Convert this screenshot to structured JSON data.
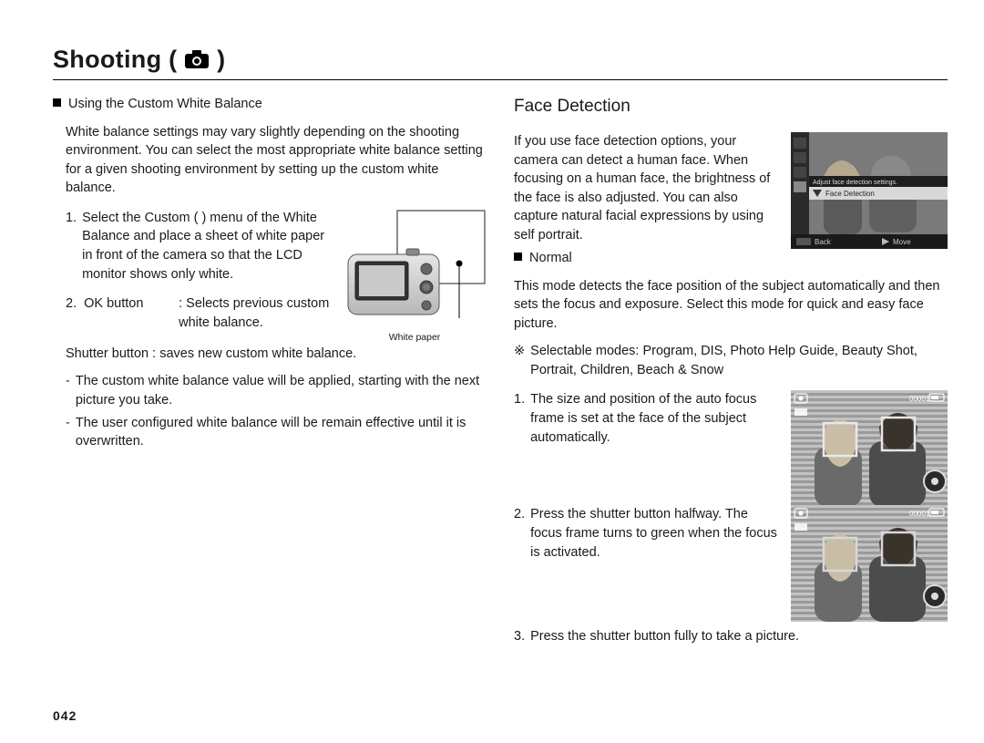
{
  "title": "Shooting (",
  "title_tail": ")",
  "left": {
    "h_custom_wb": "Using the Custom White Balance",
    "wb_intro": "White balance settings may vary slightly depending on the shooting environment. You can select the most appropriate white balance setting for a given shooting environment by setting up the custom white balance.",
    "step1_num": "1.",
    "step1": "Select the Custom (        ) menu of the White Balance and place a sheet of white paper in front of the camera so that the LCD monitor shows only white.",
    "step2_num": "2.",
    "ok_term": "OK button",
    "ok_def": ": Selects previous custom white balance.",
    "shutter_term": "Shutter button :",
    "shutter_def": "saves new custom white balance.",
    "note1": "The custom white balance value will be applied, starting with the next picture you take.",
    "note2": "The user configured white balance will be remain effective until it is overwritten.",
    "fig_caption": "White paper"
  },
  "right": {
    "heading": "Face Detection",
    "intro": "If you use face detection options, your camera can detect a human face. When focusing on a human face, the brightness of the face is also adjusted. You can also capture natural facial expressions by using self portrait.",
    "menu_hint_top": "Adjust face detection settings.",
    "menu_hint_item": "Face Detection",
    "menu_back": "Back",
    "menu_move": "Move",
    "normal_label": "Normal",
    "normal_body": "This mode detects the face position of the subject automatically and then sets the focus and exposure. Select this mode for quick and easy face picture.",
    "sel_modes_label": "Selectable modes:",
    "sel_modes": "Program, DIS, Photo Help Guide, Beauty Shot, Portrait, Children, Beach & Snow",
    "s1_num": "1.",
    "s1": "The size and position of the auto focus frame is set at the face of the subject automatically.",
    "s2_num": "2.",
    "s2": "Press the shutter button halfway. The focus frame turns to green when the focus is activated.",
    "s3_num": "3.",
    "s3": "Press the shutter button fully to take a picture.",
    "lcd_counter": "00001"
  },
  "page_number": "042"
}
